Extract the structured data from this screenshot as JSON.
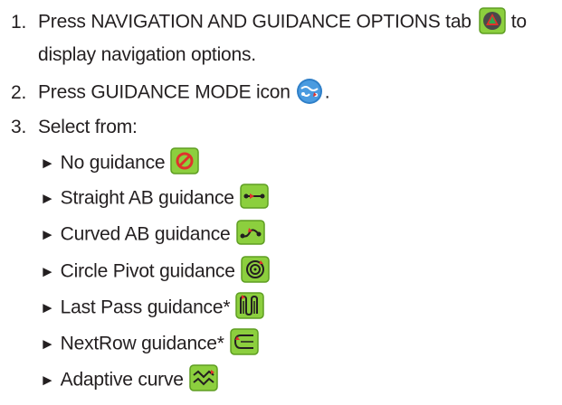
{
  "steps": [
    {
      "number": "1.",
      "text_before_icon": "Press NAVIGATION AND GUIDANCE OPTIONS tab",
      "icon": "navigation-guidance-options-tab-icon",
      "text_after_icon": "to",
      "continuation": "display navigation options."
    },
    {
      "number": "2.",
      "text_before_icon": "Press GUIDANCE MODE icon",
      "icon": "guidance-mode-icon",
      "text_after_icon": "."
    },
    {
      "number": "3.",
      "text": "Select from:"
    }
  ],
  "options": [
    {
      "bullet": "►",
      "label": "No guidance",
      "icon": "no-guidance-icon"
    },
    {
      "bullet": "►",
      "label": "Straight AB guidance",
      "icon": "straight-ab-guidance-icon"
    },
    {
      "bullet": "►",
      "label": "Curved AB guidance",
      "icon": "curved-ab-guidance-icon"
    },
    {
      "bullet": "►",
      "label": "Circle Pivot guidance",
      "icon": "circle-pivot-guidance-icon"
    },
    {
      "bullet": "►",
      "label": "Last Pass guidance*",
      "icon": "last-pass-guidance-icon"
    },
    {
      "bullet": "►",
      "label": "NextRow guidance*",
      "icon": "nextrow-guidance-icon"
    },
    {
      "bullet": "►",
      "label": "Adaptive curve",
      "icon": "adaptive-curve-icon"
    }
  ],
  "colors": {
    "text": "#231f20",
    "icon_green": "#8ccf3e",
    "icon_green_dark": "#5e9e22",
    "icon_blue": "#2f7fc8",
    "icon_red": "#e0322c"
  }
}
